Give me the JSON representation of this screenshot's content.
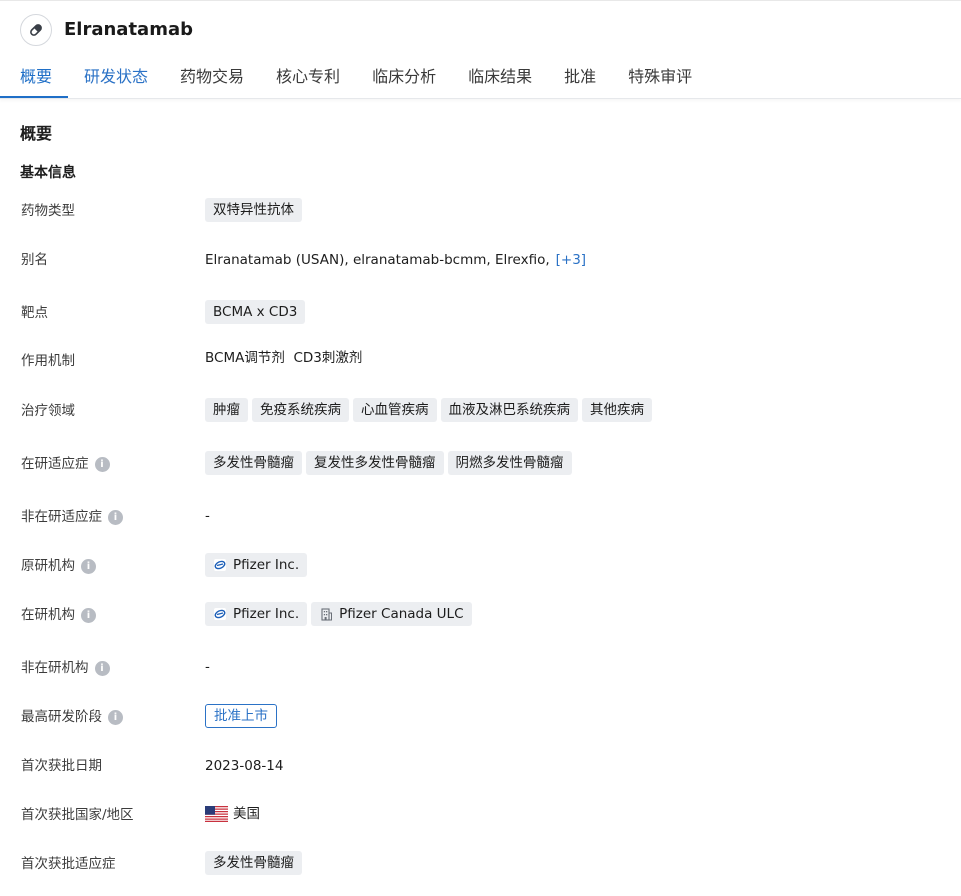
{
  "header": {
    "drug_name": "Elranatamab",
    "drug_icon": "pill-icon"
  },
  "tabs": [
    {
      "label": "概要",
      "state": "active"
    },
    {
      "label": "研发状态",
      "state": "link"
    },
    {
      "label": "药物交易",
      "state": "normal"
    },
    {
      "label": "核心专利",
      "state": "normal"
    },
    {
      "label": "临床分析",
      "state": "normal"
    },
    {
      "label": "临床结果",
      "state": "normal"
    },
    {
      "label": "批准",
      "state": "normal"
    },
    {
      "label": "特殊审评",
      "state": "normal"
    }
  ],
  "overview": {
    "title": "概要",
    "basic_info_title": "基本信息"
  },
  "fields": {
    "drug_type": {
      "label": "药物类型",
      "tags": [
        "双特异性抗体"
      ]
    },
    "aliases": {
      "label": "别名",
      "values": [
        "Elranatamab (USAN),",
        "elranatamab-bcmm,",
        "Elrexfio,"
      ],
      "more": "[+3]"
    },
    "target": {
      "label": "靶点",
      "tags": [
        "BCMA x CD3"
      ]
    },
    "mechanism": {
      "label": "作用机制",
      "values": [
        "BCMA调节剂",
        "CD3刺激剂"
      ]
    },
    "therapeutic_area": {
      "label": "治疗领域",
      "tags": [
        "肿瘤",
        "免疫系统疾病",
        "心血管疾病",
        "血液及淋巴系统疾病",
        "其他疾病"
      ]
    },
    "active_indications": {
      "label": "在研适应症",
      "tags": [
        "多发性骨髓瘤",
        "复发性多发性骨髓瘤",
        "阴燃多发性骨髓瘤"
      ]
    },
    "inactive_indications": {
      "label": "非在研适应症",
      "value": "-"
    },
    "originator": {
      "label": "原研机构",
      "orgs": [
        {
          "name": "Pfizer Inc.",
          "icon": "pfizer-logo-icon"
        }
      ]
    },
    "active_orgs": {
      "label": "在研机构",
      "orgs": [
        {
          "name": "Pfizer Inc.",
          "icon": "pfizer-logo-icon"
        },
        {
          "name": "Pfizer Canada ULC",
          "icon": "building-icon"
        }
      ]
    },
    "inactive_orgs": {
      "label": "非在研机构",
      "value": "-"
    },
    "highest_phase": {
      "label": "最高研发阶段",
      "value": "批准上市"
    },
    "first_approval_date": {
      "label": "首次获批日期",
      "value": "2023-08-14"
    },
    "first_approval_country": {
      "label": "首次获批国家/地区",
      "value": "美国",
      "flag": "us-flag-icon"
    },
    "first_approval_indication": {
      "label": "首次获批适应症",
      "tags": [
        "多发性骨髓瘤"
      ]
    }
  },
  "colors": {
    "accent": "#2b72c6",
    "tag_bg": "#eceef1",
    "info_icon": "#b8bcc3"
  }
}
